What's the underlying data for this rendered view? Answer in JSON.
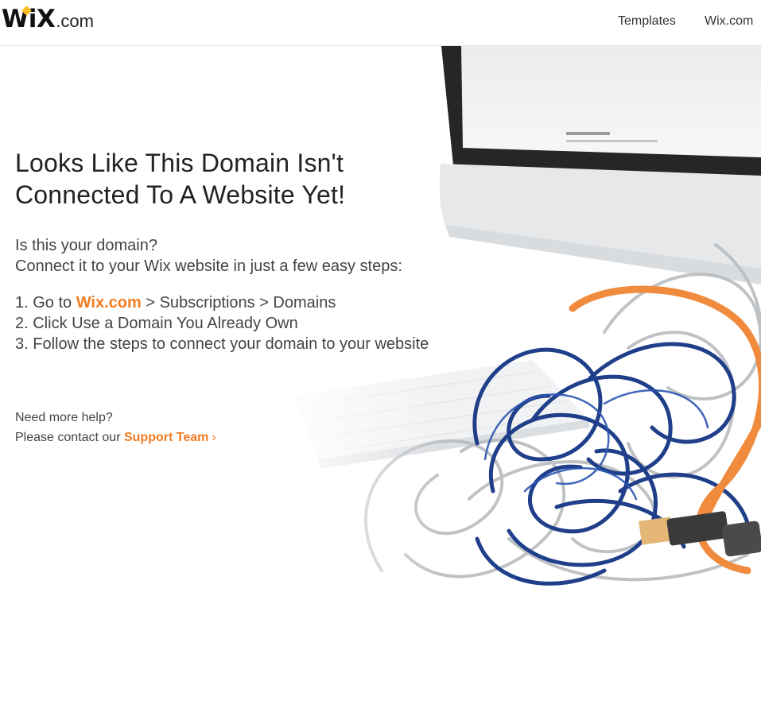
{
  "header": {
    "logo_main": "WiX",
    "logo_suffix": ".com",
    "nav": [
      {
        "label": "Templates"
      },
      {
        "label": "Wix.com"
      }
    ]
  },
  "main": {
    "title_line1": "Looks Like This Domain Isn't",
    "title_line2": "Connected To A Website Yet!",
    "intro_line1": "Is this your domain?",
    "intro_line2": "Connect it to your Wix website in just a few easy steps:",
    "steps": [
      {
        "prefix": "1. Go to ",
        "link": "Wix.com",
        "suffix": " > Subscriptions > Domains"
      },
      {
        "text": "2. Click Use a Domain You Already Own"
      },
      {
        "text": "3. Follow the steps to connect your domain to your website"
      }
    ]
  },
  "help": {
    "line1": "Need more help?",
    "line2_prefix": "Please contact our ",
    "link": "Support Team",
    "chevron": "›"
  },
  "colors": {
    "accent": "#f27c21",
    "logo_dot": "#fbbd23",
    "cable_blue": "#1f3f8a",
    "cable_orange": "#f08a3c"
  }
}
